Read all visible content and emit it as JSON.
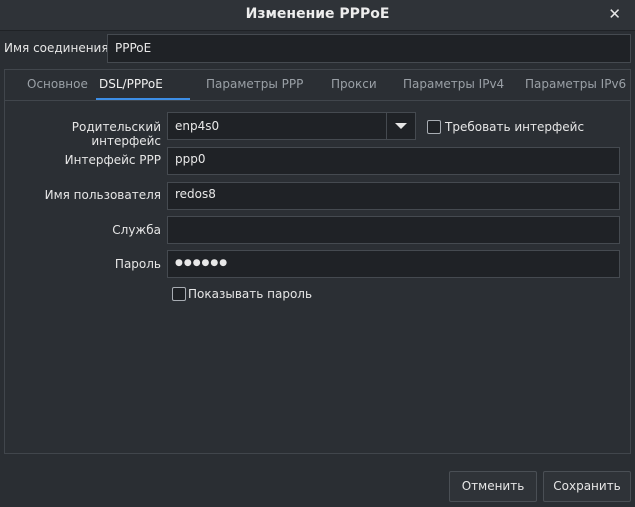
{
  "window": {
    "title": "Изменение PPPoE",
    "close_glyph": "✕"
  },
  "connection": {
    "label": "Имя соединения",
    "value": "PPPoE"
  },
  "tabs": [
    {
      "label": "Основное"
    },
    {
      "label": "DSL/PPPoE"
    },
    {
      "label": "Параметры PPP"
    },
    {
      "label": "Прокси"
    },
    {
      "label": "Параметры IPv4"
    },
    {
      "label": "Параметры IPv6"
    }
  ],
  "form": {
    "parent_label": "Родительский интерфейс",
    "parent_value": "enp4s0",
    "require_label": "Требовать интерфейс",
    "ppp_label": "Интерфейс PPP",
    "ppp_value": "ppp0",
    "user_label": "Имя пользователя",
    "user_value": "redos8",
    "service_label": "Служба",
    "service_value": "",
    "password_label": "Пароль",
    "password_value": "●●●●●●",
    "show_password_label": "Показывать пароль"
  },
  "buttons": {
    "cancel": "Отменить",
    "save": "Сохранить"
  },
  "colors": {
    "accent": "#3d8ee6",
    "background": "#2a2e33",
    "field": "#1f2226"
  }
}
